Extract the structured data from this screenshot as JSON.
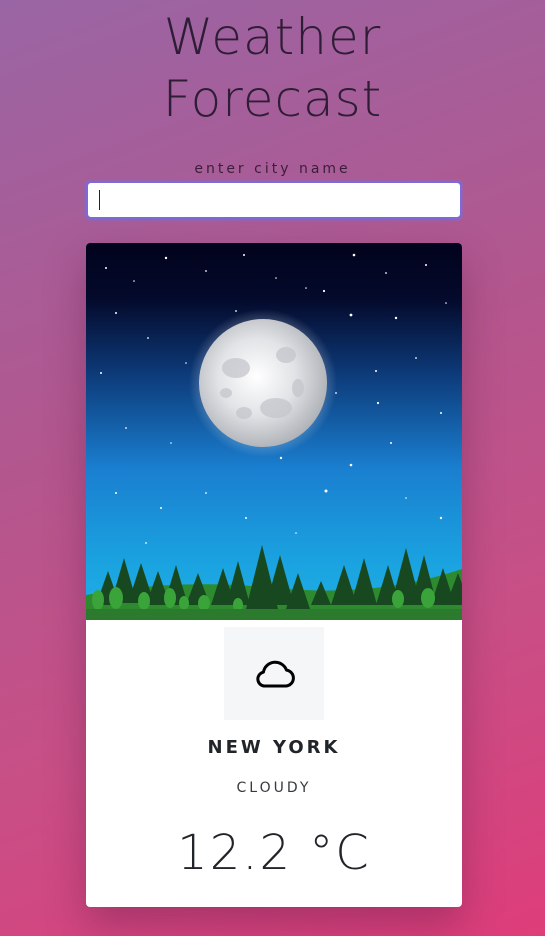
{
  "header": {
    "title_line1": "Weather",
    "title_line2": "Forecast"
  },
  "search": {
    "label": "enter city name",
    "value": "",
    "placeholder": ""
  },
  "card": {
    "image_icon": "night-moon-forest-scene",
    "weather_icon": "cloud-icon",
    "city": "NEW YORK",
    "condition": "CLOUDY",
    "temperature": "12.2 °C"
  },
  "colors": {
    "input_focus_border": "#7e6ad6",
    "sky_top": "#020420",
    "sky_bottom": "#1aa0dc",
    "text_dark": "#212529"
  }
}
